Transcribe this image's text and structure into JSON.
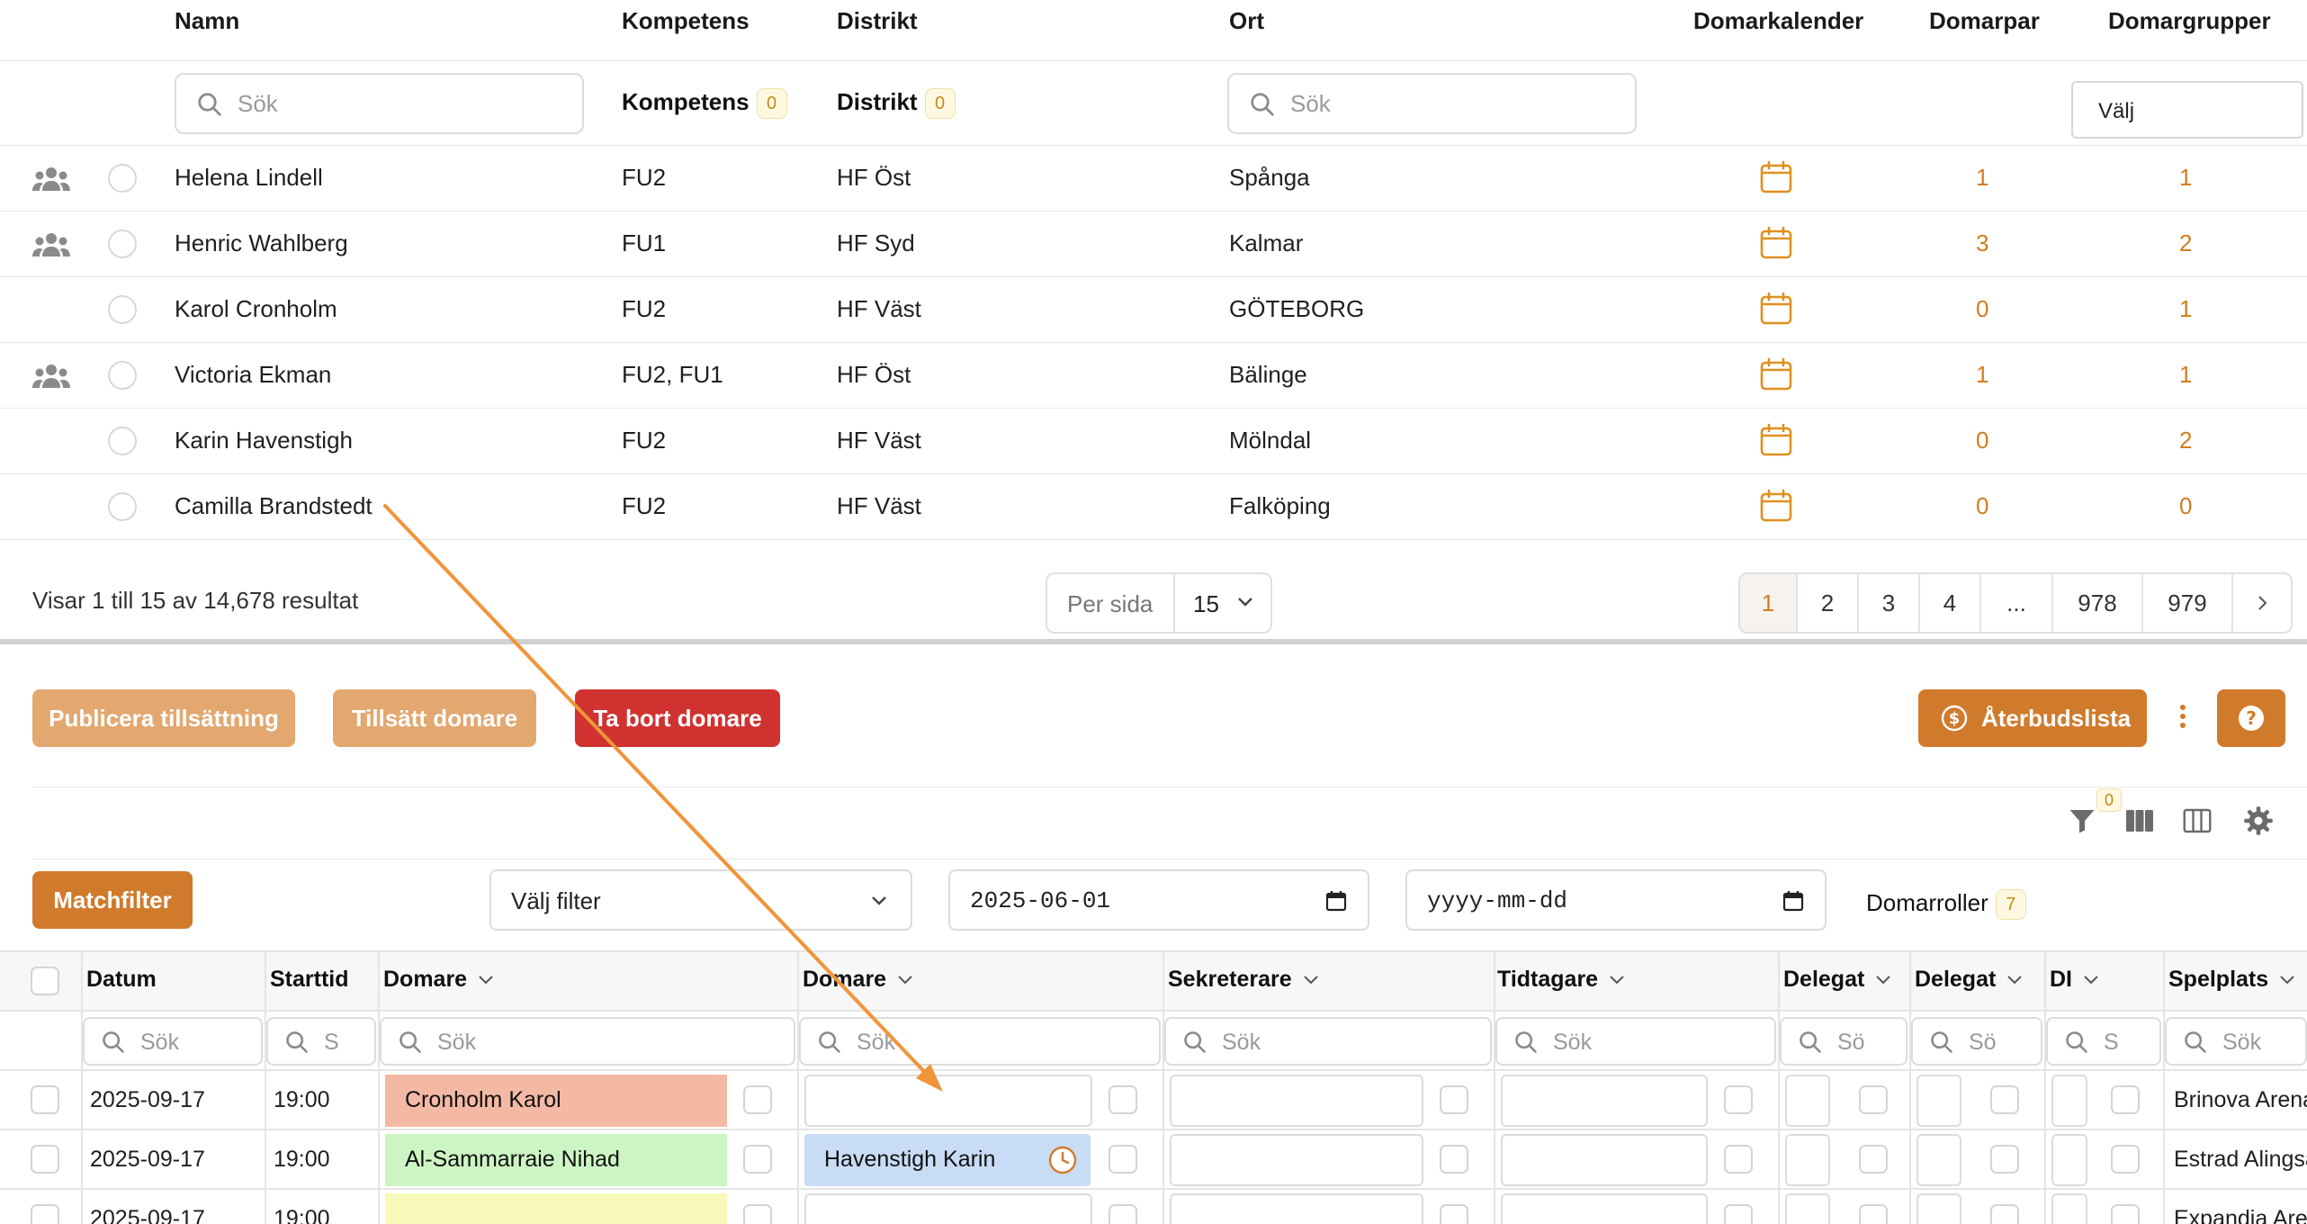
{
  "referee_table": {
    "columns": {
      "name": "Namn",
      "competence": "Kompetens",
      "district": "Distrikt",
      "city": "Ort",
      "calendar": "Domarkalender",
      "pairs": "Domarpar",
      "groups": "Domargrupper"
    },
    "filters": {
      "name_placeholder": "Sök",
      "competence_label": "Kompetens",
      "competence_count": "0",
      "district_label": "Distrikt",
      "district_count": "0",
      "city_placeholder": "Sök",
      "groups_select": "Välj"
    },
    "rows": [
      {
        "group": true,
        "name": "Helena Lindell",
        "competence": "FU2",
        "district": "HF Öst",
        "city": "Spånga",
        "pairs": "1",
        "groups": "1"
      },
      {
        "group": true,
        "name": "Henric Wahlberg",
        "competence": "FU1",
        "district": "HF Syd",
        "city": "Kalmar",
        "pairs": "3",
        "groups": "2"
      },
      {
        "group": false,
        "name": "Karol Cronholm",
        "competence": "FU2",
        "district": "HF Väst",
        "city": "GÖTEBORG",
        "pairs": "0",
        "groups": "1"
      },
      {
        "group": true,
        "name": "Victoria Ekman",
        "competence": "FU2, FU1",
        "district": "HF Öst",
        "city": "Bälinge",
        "pairs": "1",
        "groups": "1"
      },
      {
        "group": false,
        "name": "Karin Havenstigh",
        "competence": "FU2",
        "district": "HF Väst",
        "city": "Mölndal",
        "pairs": "0",
        "groups": "2"
      },
      {
        "group": false,
        "name": "Camilla Brandstedt",
        "competence": "FU2",
        "district": "HF Väst",
        "city": "Falköping",
        "pairs": "0",
        "groups": "0"
      }
    ],
    "footer": {
      "showing": "Visar 1 till 15 av 14,678 resultat",
      "per_page_label": "Per sida",
      "per_page_value": "15",
      "pages": [
        "1",
        "2",
        "3",
        "4",
        "...",
        "978",
        "979"
      ],
      "active_page": "1"
    }
  },
  "actions": {
    "publish": "Publicera tillsättning",
    "assign": "Tillsätt domare",
    "remove": "Ta bort domare",
    "cancellations": "Återbudslista",
    "help": "?"
  },
  "toolbar": {
    "filter_count": "0"
  },
  "match_filters": {
    "button": "Matchfilter",
    "filter_select": "Välj filter",
    "date_from": "2025-06-01",
    "date_to": "yyyy-mm-dd",
    "roles_label": "Domarroller",
    "roles_count": "7"
  },
  "match_grid": {
    "headers": {
      "date": "Datum",
      "start": "Starttid",
      "referee1": "Domare",
      "referee2": "Domare",
      "secretary": "Sekreterare",
      "timekeeper": "Tidtagare",
      "delegate1": "Delegat",
      "delegate2": "Delegat",
      "di": "DI",
      "venue": "Spelplats"
    },
    "search_placeholders": {
      "full": "Sök",
      "trunc_start": "S",
      "trunc_so": "Sö",
      "trunc_s": "S"
    },
    "rows": [
      {
        "date": "2025-09-17",
        "time": "19:00",
        "ref1": "Cronholm Karol",
        "ref2": "",
        "venue": "Brinova Arena"
      },
      {
        "date": "2025-09-17",
        "time": "19:00",
        "ref1": "Al-Sammarraie Nihad",
        "ref2": "Havenstigh Karin",
        "venue": "Estrad Alingsås"
      },
      {
        "date": "2025-09-17",
        "time": "19:00",
        "ref1": "",
        "ref2": "",
        "venue": "Expandia Arena"
      }
    ]
  },
  "colors": {
    "accent": "#d07b2b",
    "accent_light": "#e2a86f",
    "danger": "#d03230",
    "ref_red": "#f4b9a5",
    "ref_green": "#cdf5c4",
    "ref_yellow": "#f8f9b8",
    "ref_blue": "#c9dcf5",
    "drag_arrow": "#f0953a"
  }
}
